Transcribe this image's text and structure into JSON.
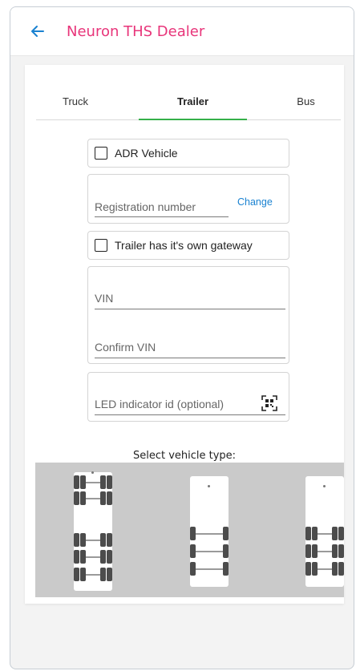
{
  "app": {
    "title": "Neuron THS Dealer"
  },
  "tabs": [
    {
      "label": "Truck",
      "active": false
    },
    {
      "label": "Trailer",
      "active": true
    },
    {
      "label": "Bus",
      "active": false
    }
  ],
  "form": {
    "adr_label": "ADR Vehicle",
    "registration_placeholder": "Registration number",
    "change_label": "Change",
    "gateway_label": "Trailer has it's own gateway",
    "vin_placeholder": "VIN",
    "confirm_vin_placeholder": "Confirm VIN",
    "led_placeholder": "LED indicator id (optional)"
  },
  "vehicle_select": {
    "label": "Select vehicle type:",
    "types": [
      {
        "name": "dual-wheel-5-axle"
      },
      {
        "name": "single-wheel-3-axle"
      },
      {
        "name": "dual-wheel-3-axle"
      }
    ]
  },
  "colors": {
    "accent": "#e8357a",
    "tab_indicator": "#35b049",
    "link": "#1a82d1"
  }
}
